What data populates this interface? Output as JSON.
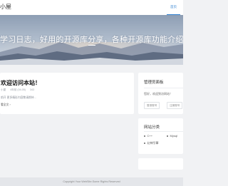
{
  "header": {
    "site_title": "小屋",
    "nav_home": "首页"
  },
  "hero": {
    "tagline": "学习日志，好用的开源库分享，各种开源库功能介绍"
  },
  "welcome": {
    "title": "欢迎访问本站！",
    "meta_author": "小屋",
    "meta_date": "4年前 (04-05)",
    "meta_views": "343",
    "excerpt": "前开 更多精彩内容敬请期待...",
    "read_more": "看全文 ›"
  },
  "admin": {
    "title": "管理员面板",
    "hello": "您好，欢迎到访网站！",
    "btn_login": "登录账号",
    "btn_register": "注册账号"
  },
  "categories": {
    "title": "网站分类",
    "items": [
      "C++",
      "Mysql",
      "幻神引擎"
    ]
  },
  "footer": {
    "copyright": "Copyright Your WebSite.Some Rights Reserved"
  },
  "colors": {
    "accent": "#2f80d1",
    "page_bg": "#f1f2f4"
  }
}
